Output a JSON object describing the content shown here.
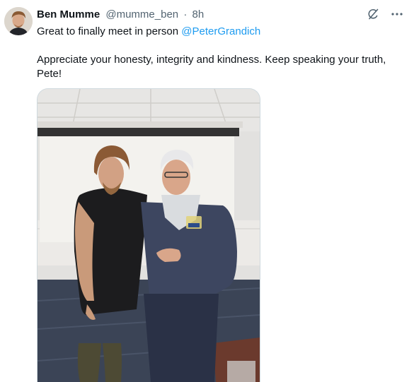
{
  "post": {
    "author_name": "Ben Mumme",
    "author_handle": "@mumme_ben",
    "separator": "·",
    "time": "8h",
    "line1_text": "Great to finally meet in person ",
    "mention": "@PeterGrandich",
    "line2_text": "Appreciate your honesty, integrity and kindness. Keep speaking your truth, Pete!"
  },
  "icons": {
    "grok": "grok-slash-icon",
    "more": "more-dots-icon"
  },
  "colors": {
    "link": "#1d9bf0",
    "muted": "#536471",
    "text": "#0f1419"
  }
}
